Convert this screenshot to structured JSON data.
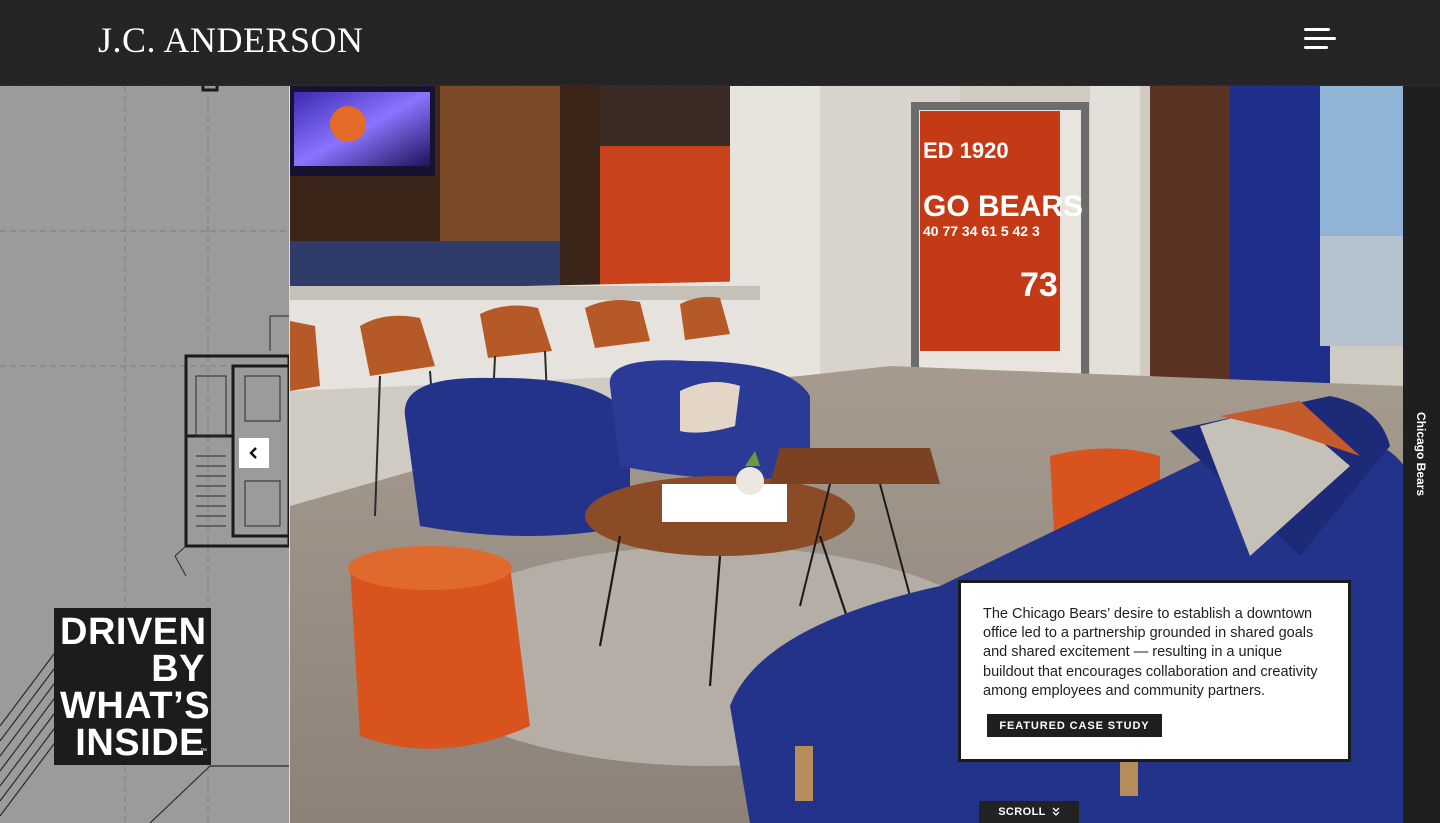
{
  "header": {
    "logo_text": "J.C. ANDERSON",
    "menu_icon": "hamburger-menu-icon"
  },
  "hero": {
    "tagline_lines": [
      "DRIVEN",
      "BY",
      "WHAT’S",
      "INSIDE"
    ],
    "tagline_tm": "™",
    "prev_icon": "chevron-left-icon",
    "next_icon": "chevron-right-icon",
    "project_label": "Chicago Bears",
    "caption": "The Chicago Bears’ desire to establish a downtown office led to a partnership grounded in shared goals and shared excitement — resulting in a unique buildout that encourages collaboration and creativity among employees and community partners.",
    "cta_label": "FEATURED CASE STUDY",
    "scroll_label": "SCROLL",
    "scroll_icon": "double-chevron-down-icon"
  },
  "colors": {
    "header_bg": "#232323",
    "accent_dark": "#1f1f1f",
    "blueprint_bg": "#9b9b9b",
    "bears_orange": "#d9531e",
    "navy_upholstery": "#24338a"
  }
}
